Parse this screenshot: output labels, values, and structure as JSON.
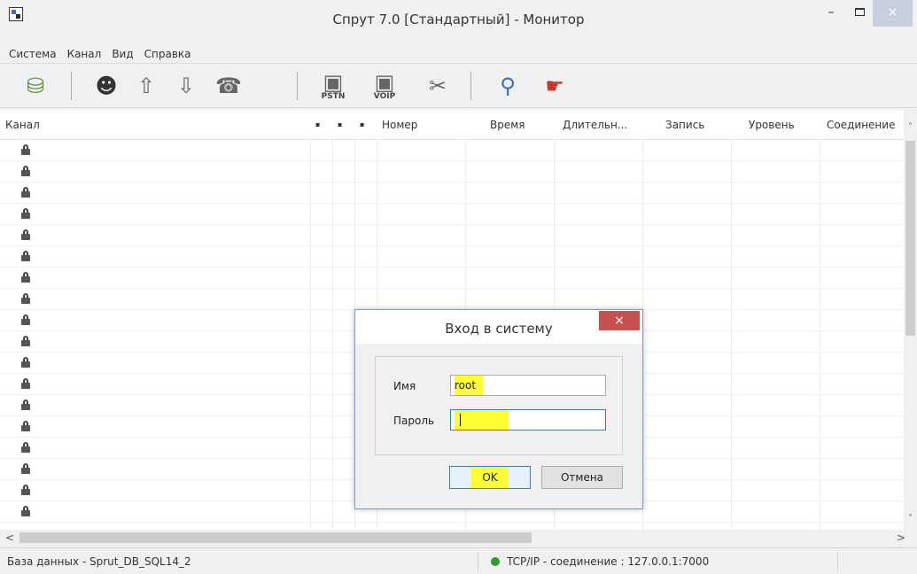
{
  "window": {
    "title": "Спрут 7.0 [Стандартный] - Монитор",
    "icons": {
      "app": "app-window-icon",
      "minimize": "minimize-icon",
      "maximize": "maximize-icon",
      "close": "close-icon"
    },
    "glyphs": {
      "minimize": "–",
      "close": "×"
    }
  },
  "menu": {
    "items": [
      "Система",
      "Канал",
      "Вид",
      "Справка"
    ]
  },
  "toolbar": {
    "buttons": [
      {
        "icon": "connect-icon"
      },
      {
        "icon": "operator-icon"
      },
      {
        "icon": "arrow-up-icon"
      },
      {
        "icon": "arrow-down-icon"
      },
      {
        "icon": "telephone-icon"
      },
      {
        "icon": "pstn-device-icon",
        "label": "PSTN"
      },
      {
        "icon": "voip-device-icon",
        "label": "VOIP"
      },
      {
        "icon": "settings-tools-icon"
      },
      {
        "icon": "search-user-icon"
      },
      {
        "icon": "help-database-icon"
      }
    ],
    "glyphs": [
      "⛁",
      "☻",
      "⇧",
      "⇩",
      "☎",
      "▣",
      "▣",
      "✂",
      "⚲",
      "☛"
    ]
  },
  "grid": {
    "columns": [
      "Канал",
      "▪",
      "▪",
      "▪",
      "Номер",
      "Время",
      "Длительн...",
      "Запись",
      "Уровень",
      "Соединение"
    ],
    "row_icon": "padlock-icon",
    "row_count": 18
  },
  "scroll": {
    "up": "˄",
    "down": "˅",
    "left": "<",
    "right": ">"
  },
  "status": {
    "database": "База данных - Sprut_DB_SQL14_2",
    "connection": "TCP/IP - соединение : 127.0.0.1:7000",
    "led_color": "#2e9a3a"
  },
  "login_dialog": {
    "title": "Вход в систему",
    "close_glyph": "×",
    "username_label": "Имя",
    "username_value": "root",
    "password_label": "Пароль",
    "password_value": "",
    "ok_label": "OK",
    "cancel_label": "Отмена",
    "highlight_color": "#ffff33"
  }
}
